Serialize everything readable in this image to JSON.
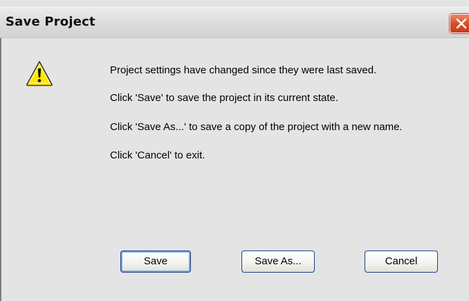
{
  "window": {
    "title": "Save Project"
  },
  "dialog": {
    "icon": "warning-icon",
    "lines": [
      "Project settings have changed since they were last saved.",
      "Click 'Save' to save the project in its current state.",
      "Click 'Save As...' to save a copy of the project with a new name.",
      "Click 'Cancel' to exit."
    ]
  },
  "buttons": {
    "save": "Save",
    "save_as": "Save As...",
    "cancel": "Cancel"
  },
  "colors": {
    "close_button": "#d4502b",
    "warning_fill": "#ffe800",
    "default_button_border": "#7fa6e6"
  }
}
